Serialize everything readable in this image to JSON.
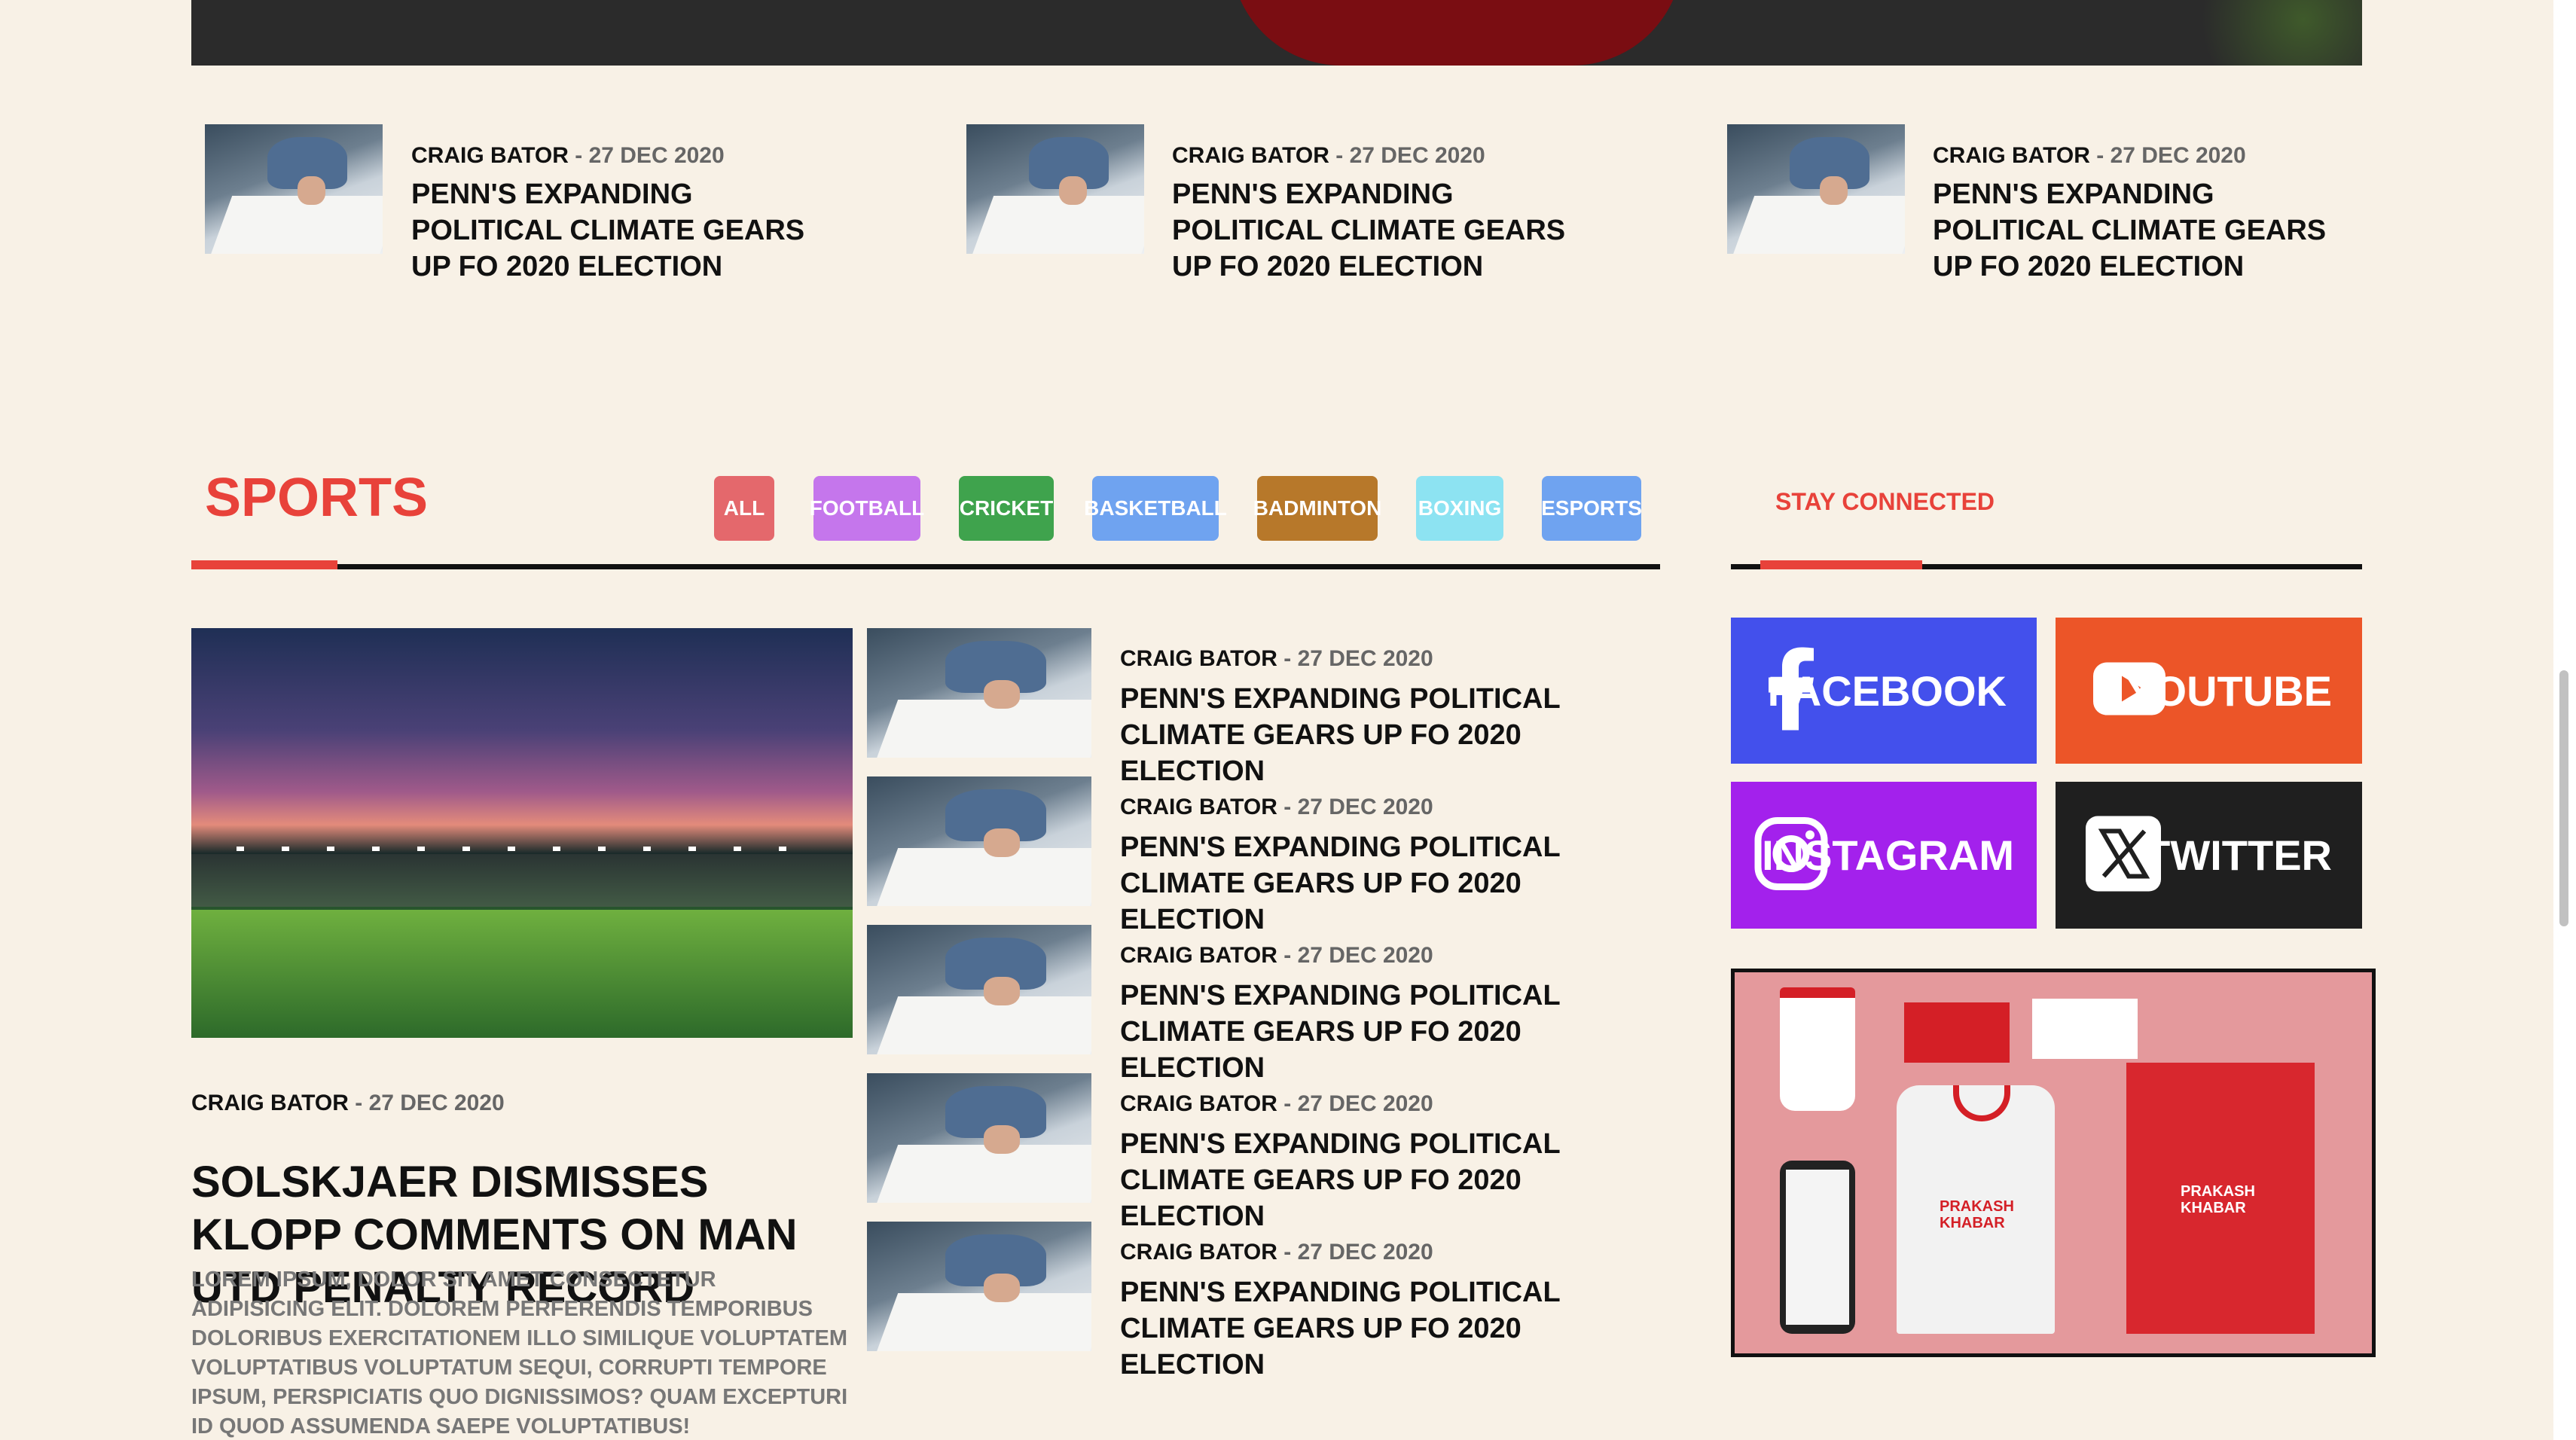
{
  "top_articles": [
    {
      "author": "CRAIG BATOR",
      "date": "27 DEC 2020",
      "headline": "PENN'S EXPANDING POLITICAL CLIMATE GEARS UP FO 2020 ELECTION"
    },
    {
      "author": "CRAIG BATOR",
      "date": "27 DEC 2020",
      "headline": "PENN'S EXPANDING POLITICAL CLIMATE GEARS UP FO 2020 ELECTION"
    },
    {
      "author": "CRAIG BATOR",
      "date": "27 DEC 2020",
      "headline": "PENN'S EXPANDING POLITICAL CLIMATE GEARS UP FO 2020 ELECTION"
    }
  ],
  "separator": " - ",
  "sports": {
    "title": "SPORTS",
    "filters": [
      {
        "label": "ALL",
        "color": "#e4686c"
      },
      {
        "label": "FOOTBALL",
        "color": "#c576ec"
      },
      {
        "label": "CRICKET",
        "color": "#3fa34d"
      },
      {
        "label": "BASKETBALL",
        "color": "#6fa3f0"
      },
      {
        "label": "BADMINTON",
        "color": "#b7782a"
      },
      {
        "label": "BOXING",
        "color": "#8de3f2"
      },
      {
        "label": "ESPORTS",
        "color": "#6fa3f0"
      }
    ],
    "feature": {
      "author": "CRAIG BATOR",
      "date": "27 DEC 2020",
      "headline": "SOLSKJAER DISMISSES KLOPP COMMENTS ON MAN UTD PENALTY RECORD",
      "excerpt": "LOREM IPSUM, DOLOR SIT AMET CONSECTETUR ADIPISICING ELIT. DOLOREM PERFERENDIS TEMPORIBUS DOLORIBUS EXERCITATIONEM ILLO SIMILIQUE VOLUPTATEM VOLUPTATIBUS VOLUPTATUM SEQUI, CORRUPTI TEMPORE IPSUM, PERSPICIATIS QUO DIGNISSIMOS? QUAM EXCEPTURI ID QUOD ASSUMENDA SAEPE VOLUPTATIBUS!"
    },
    "list": [
      {
        "author": "CRAIG BATOR",
        "date": "27 DEC 2020",
        "headline": "PENN'S EXPANDING POLITICAL CLIMATE GEARS UP FO 2020 ELECTION"
      },
      {
        "author": "CRAIG BATOR",
        "date": "27 DEC 2020",
        "headline": "PENN'S EXPANDING POLITICAL CLIMATE GEARS UP FO 2020 ELECTION"
      },
      {
        "author": "CRAIG BATOR",
        "date": "27 DEC 2020",
        "headline": "PENN'S EXPANDING POLITICAL CLIMATE GEARS UP FO 2020 ELECTION"
      },
      {
        "author": "CRAIG BATOR",
        "date": "27 DEC 2020",
        "headline": "PENN'S EXPANDING POLITICAL CLIMATE GEARS UP FO 2020 ELECTION"
      },
      {
        "author": "CRAIG BATOR",
        "date": "27 DEC 2020",
        "headline": "PENN'S EXPANDING POLITICAL CLIMATE GEARS UP FO 2020 ELECTION"
      }
    ]
  },
  "stay_connected": {
    "title": "STAY CONNECTED",
    "socials": [
      {
        "label": "FACEBOOK",
        "icon": "facebook-icon",
        "color": "#4350ec"
      },
      {
        "label": "YOUTUBE",
        "icon": "youtube-icon",
        "color": "#ec5528"
      },
      {
        "label": "INSTAGRAM",
        "icon": "instagram-icon",
        "color": "#a321ec"
      },
      {
        "label": "TWITTER",
        "icon": "x-twitter-icon",
        "color": "#1f1f1f"
      }
    ]
  },
  "ad": {
    "brand_line1": "PRAKASH",
    "brand_line2": "KHABAR"
  },
  "colors": {
    "accent": "#e8423a",
    "background": "#f8f1e6"
  }
}
